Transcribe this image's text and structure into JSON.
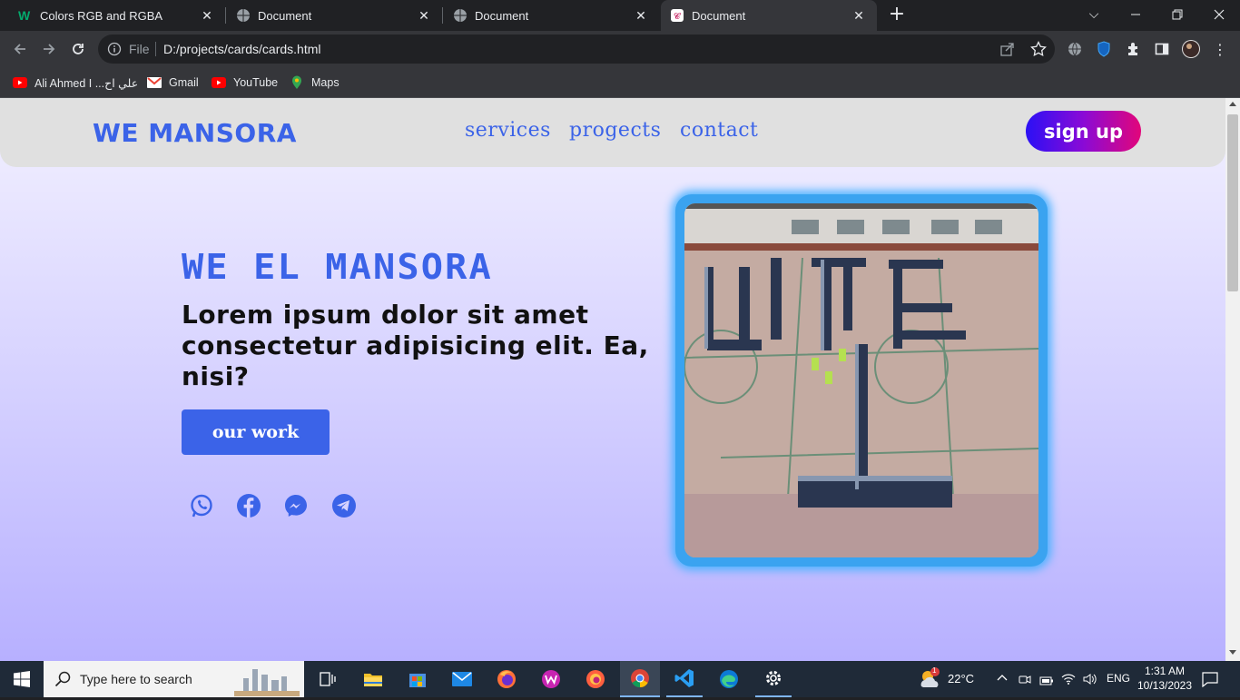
{
  "browser": {
    "tabs": [
      {
        "title": "Colors RGB and RGBA",
        "active": false
      },
      {
        "title": "Document",
        "active": false
      },
      {
        "title": "Document",
        "active": false
      },
      {
        "title": "Document",
        "active": true
      }
    ],
    "address": {
      "scheme_label": "File",
      "url": "D:/projects/cards/cards.html"
    },
    "bookmarks": [
      {
        "label": "Ali Ahmed I ...علي اح",
        "icon": "youtube-icon"
      },
      {
        "label": "Gmail",
        "icon": "gmail-icon"
      },
      {
        "label": "YouTube",
        "icon": "youtube-icon"
      },
      {
        "label": "Maps",
        "icon": "maps-icon"
      }
    ]
  },
  "site": {
    "brand": "WE MANSORA",
    "nav": [
      "services",
      "progects",
      "contact"
    ],
    "signup": "sign up",
    "hero": {
      "title": "WE EL MANSORA",
      "text": "Lorem ipsum dolor sit amet consectetur adipisicing elit. Ea, nisi?",
      "button": "our work"
    },
    "social_icons": [
      "whatsapp-icon",
      "facebook-icon",
      "messenger-icon",
      "telegram-icon"
    ],
    "accent_color": "#3b63e8"
  },
  "taskbar": {
    "search_placeholder": "Type here to search",
    "weather": "22°C",
    "language": "ENG",
    "time": "1:31 AM",
    "date": "10/13/2023",
    "weather_badge": "1"
  }
}
